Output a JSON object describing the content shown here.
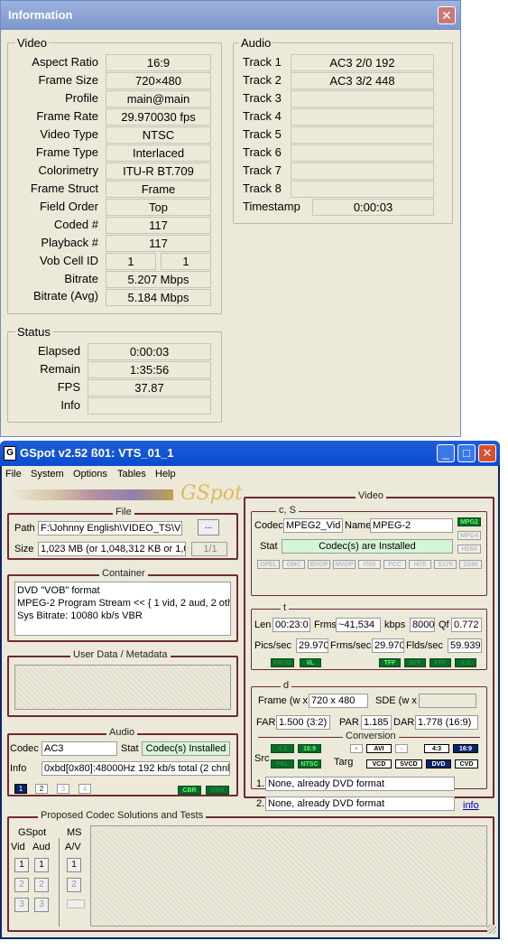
{
  "info_window": {
    "title": "Information",
    "video": {
      "group_label": "Video",
      "rows": [
        {
          "label": "Aspect Ratio",
          "value": "16:9"
        },
        {
          "label": "Frame Size",
          "value": "720×480"
        },
        {
          "label": "Profile",
          "value": "main@main"
        },
        {
          "label": "Frame Rate",
          "value": "29.970030 fps"
        },
        {
          "label": "Video Type",
          "value": "NTSC"
        },
        {
          "label": "Frame Type",
          "value": "Interlaced"
        },
        {
          "label": "Colorimetry",
          "value": "ITU-R BT.709"
        },
        {
          "label": "Frame Struct",
          "value": "Frame"
        },
        {
          "label": "Field Order",
          "value": "Top"
        },
        {
          "label": "Coded #",
          "value": "117"
        },
        {
          "label": "Playback #",
          "value": "117"
        }
      ],
      "vob_cell": {
        "label": "Vob Cell ID",
        "value1": "1",
        "value2": "1"
      },
      "bitrate": {
        "label": "Bitrate",
        "value": "5.207 Mbps"
      },
      "bitrate_avg": {
        "label": "Bitrate (Avg)",
        "value": "5.184 Mbps"
      }
    },
    "audio": {
      "group_label": "Audio",
      "tracks": [
        {
          "label": "Track 1",
          "value": "AC3 2/0 192"
        },
        {
          "label": "Track 2",
          "value": "AC3 3/2 448"
        },
        {
          "label": "Track 3",
          "value": ""
        },
        {
          "label": "Track 4",
          "value": ""
        },
        {
          "label": "Track 5",
          "value": ""
        },
        {
          "label": "Track 6",
          "value": ""
        },
        {
          "label": "Track 7",
          "value": ""
        },
        {
          "label": "Track 8",
          "value": ""
        }
      ],
      "timestamp": {
        "label": "Timestamp",
        "value": "0:00:03"
      }
    },
    "status": {
      "group_label": "Status",
      "rows": [
        {
          "label": "Elapsed",
          "value": "0:00:03"
        },
        {
          "label": "Remain",
          "value": "1:35:56"
        },
        {
          "label": "FPS",
          "value": "37.87"
        },
        {
          "label": "Info",
          "value": ""
        }
      ]
    }
  },
  "gspot": {
    "title": "GSpot v2.52 ß01: VTS_01_1",
    "menu": [
      "File",
      "System",
      "Options",
      "Tables",
      "Help"
    ],
    "logo_text": "GSpot",
    "file": {
      "group_label": "File",
      "path_label": "Path",
      "path_value": "F:\\Johnny English\\VIDEO_TS\\V",
      "browse_label": "...",
      "size_label": "Size",
      "size_value": "1,023 MB (or 1,048,312 KB or 1,0",
      "counter": "1/1"
    },
    "container": {
      "group_label": "Container",
      "lines": [
        "DVD \"VOB\" format",
        "MPEG-2 Program Stream << { 1 vid, 2 aud, 2 othe",
        "Sys Bitrate: 10080 kb/s VBR"
      ]
    },
    "userdata": {
      "group_label": "User Data / Metadata"
    },
    "audio": {
      "group_label": "Audio",
      "codec_label": "Codec",
      "codec_value": "AC3",
      "stat_label": "Stat",
      "stat_value": "Codec(s) Installed",
      "info_label": "Info",
      "info_value": "0xbd[0x80]:48000Hz  192 kb/s total (2 chnl",
      "nums": [
        "1",
        "2",
        "3",
        "4"
      ],
      "cbr": "CBR",
      "vbr": "VBR"
    },
    "video": {
      "group_label": "Video",
      "cs": {
        "label": "c, S",
        "codec_label": "Codec",
        "codec_value": "MPEG2_Vid",
        "name_label": "Name",
        "name_value": "MPEG-2",
        "stat_label": "Stat",
        "stat_value": "Codec(s) are Installed",
        "side_badges": [
          "MPG2",
          "MPG4",
          "H264"
        ],
        "badges": [
          "OPEL",
          "GMC",
          "BVOP",
          "NVOP",
          "I703",
          "FCC",
          "I470",
          "S170",
          "S240"
        ]
      },
      "t": {
        "label": "t",
        "len_label": "Len",
        "len_value": "00:23:0",
        "frms_label": "Frms",
        "frms_value": "~41,534",
        "kbps_label": "kbps",
        "kbps_value": "8000",
        "qf_label": "Qf",
        "qf_value": "0.772",
        "pics_label": "Pics/sec",
        "pics_value": "29.970",
        "frmsec_label": "Frms/sec",
        "frmsec_value": "29.970",
        "flds_label": "Flds/sec",
        "flds_value": "59.939",
        "badges_left": [
          "PROG",
          "I/L"
        ],
        "badges_right": [
          "TFF",
          "BFF",
          "FFF",
          "3:2"
        ]
      },
      "d": {
        "label": "d",
        "frame_label": "Frame (w x",
        "frame_value": "720 x 480",
        "sde_label": "SDE (w x",
        "sde_value": "",
        "far_label": "FAR",
        "far_value": "1.500 (3:2)",
        "par_label": "PAR",
        "par_value": "1.185",
        "dar_label": "DAR",
        "dar_value": "1.778 (16:9)",
        "conversion_label": "Conversion",
        "conv_buttons": [
          "+",
          "AVI",
          "-"
        ],
        "aspect_buttons": [
          "4:3",
          "16:9"
        ],
        "src_label": "Src",
        "src_badges": [
          "4:3",
          "16:9",
          "PAL",
          "NTSC"
        ],
        "targ_label": "Targ",
        "targ_buttons": [
          "VCD",
          "SVCD",
          "DVD",
          "CVD"
        ],
        "line1": "1.",
        "line1_value": "None, already DVD format",
        "line2": "2.",
        "line2_value": "None, already DVD format",
        "info_link": "info"
      }
    },
    "proposed": {
      "group_label": "Proposed Codec Solutions and Tests",
      "gspot_label": "GSpot",
      "ms_label": "MS",
      "vid_label": "Vid",
      "aud_label": "Aud",
      "av_label": "A/V",
      "vid_nums": [
        "1",
        "2",
        "3"
      ],
      "aud_nums": [
        "1",
        "2",
        "3"
      ],
      "av_nums": [
        "1",
        "2"
      ]
    }
  }
}
